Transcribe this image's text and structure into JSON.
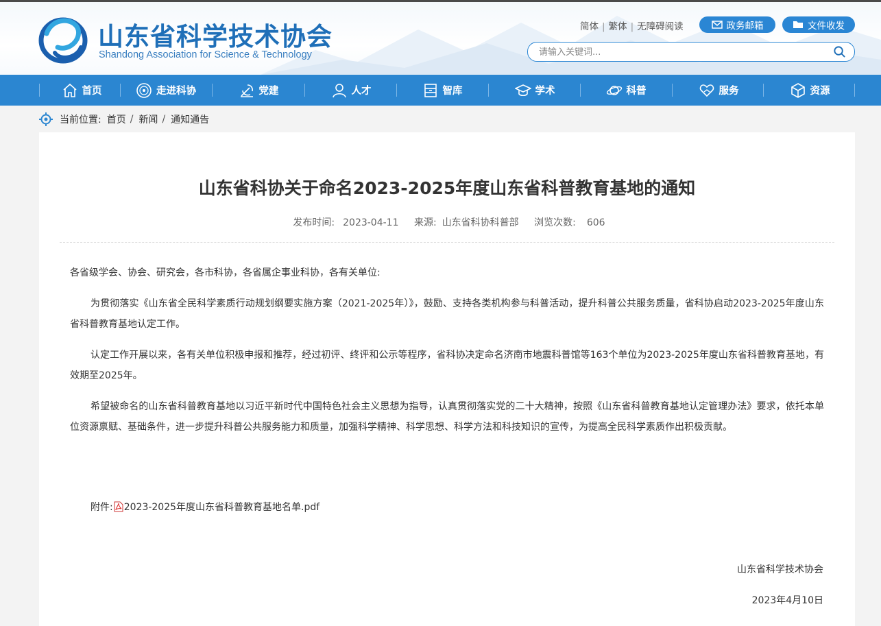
{
  "header": {
    "logo_cn": "山东省科学技术协会",
    "logo_en": "Shandong Association for Science & Technology",
    "utility_links": [
      "简体",
      "繁体",
      "无障碍阅读"
    ],
    "mail_label": "政务邮箱",
    "file_label": "文件收发",
    "search_placeholder": "请输入关键词..."
  },
  "nav": {
    "items": [
      {
        "label": "首页",
        "icon": "home-icon"
      },
      {
        "label": "走进科协",
        "icon": "emblem-icon"
      },
      {
        "label": "党建",
        "icon": "party-icon"
      },
      {
        "label": "人才",
        "icon": "person-icon"
      },
      {
        "label": "智库",
        "icon": "archive-icon"
      },
      {
        "label": "学术",
        "icon": "graduation-cap-icon"
      },
      {
        "label": "科普",
        "icon": "planet-icon"
      },
      {
        "label": "服务",
        "icon": "heart-hand-icon"
      },
      {
        "label": "资源",
        "icon": "cube-icon"
      }
    ]
  },
  "breadcrumb": {
    "prefix": "当前位置:",
    "items": [
      "首页",
      "新闻",
      "通知通告"
    ]
  },
  "article": {
    "title": "山东省科协关于命名2023-2025年度山东省科普教育基地的通知",
    "publish_label": "发布时间:",
    "publish_date": "2023-04-11",
    "source_label": "来源:",
    "source": "山东省科协科普部",
    "views_label": "浏览次数:",
    "views": "606",
    "salutation": "各省级学会、协会、研究会，各市科协，各省属企事业科协，各有关单位:",
    "paragraphs": [
      "为贯彻落实《山东省全民科学素质行动规划纲要实施方案（2021-2025年）》，鼓励、支持各类机构参与科普活动，提升科普公共服务质量，省科协启动2023-2025年度山东省科普教育基地认定工作。",
      "认定工作开展以来，各有关单位积极申报和推荐，经过初评、终评和公示等程序，省科协决定命名济南市地震科普馆等163个单位为2023-2025年度山东省科普教育基地，有效期至2025年。",
      "希望被命名的山东省科普教育基地以习近平新时代中国特色社会主义思想为指导，认真贯彻落实党的二十大精神，按照《山东省科普教育基地认定管理办法》要求，依托本单位资源禀赋、基础条件，进一步提升科普公共服务能力和质量，加强科学精神、科学思想、科学方法和科技知识的宣传，为提高全民科学素质作出积极贡献。"
    ],
    "attachment_label": "附件:",
    "attachment_file": "2023-2025年度山东省科普教育基地名单.pdf",
    "signature": "山东省科学技术协会",
    "sign_date": "2023年4月10日"
  },
  "colors": {
    "nav_bg": "#2b86d1",
    "brand_blue": "#1f6fb8",
    "pill_bg": "#2a86d4"
  }
}
